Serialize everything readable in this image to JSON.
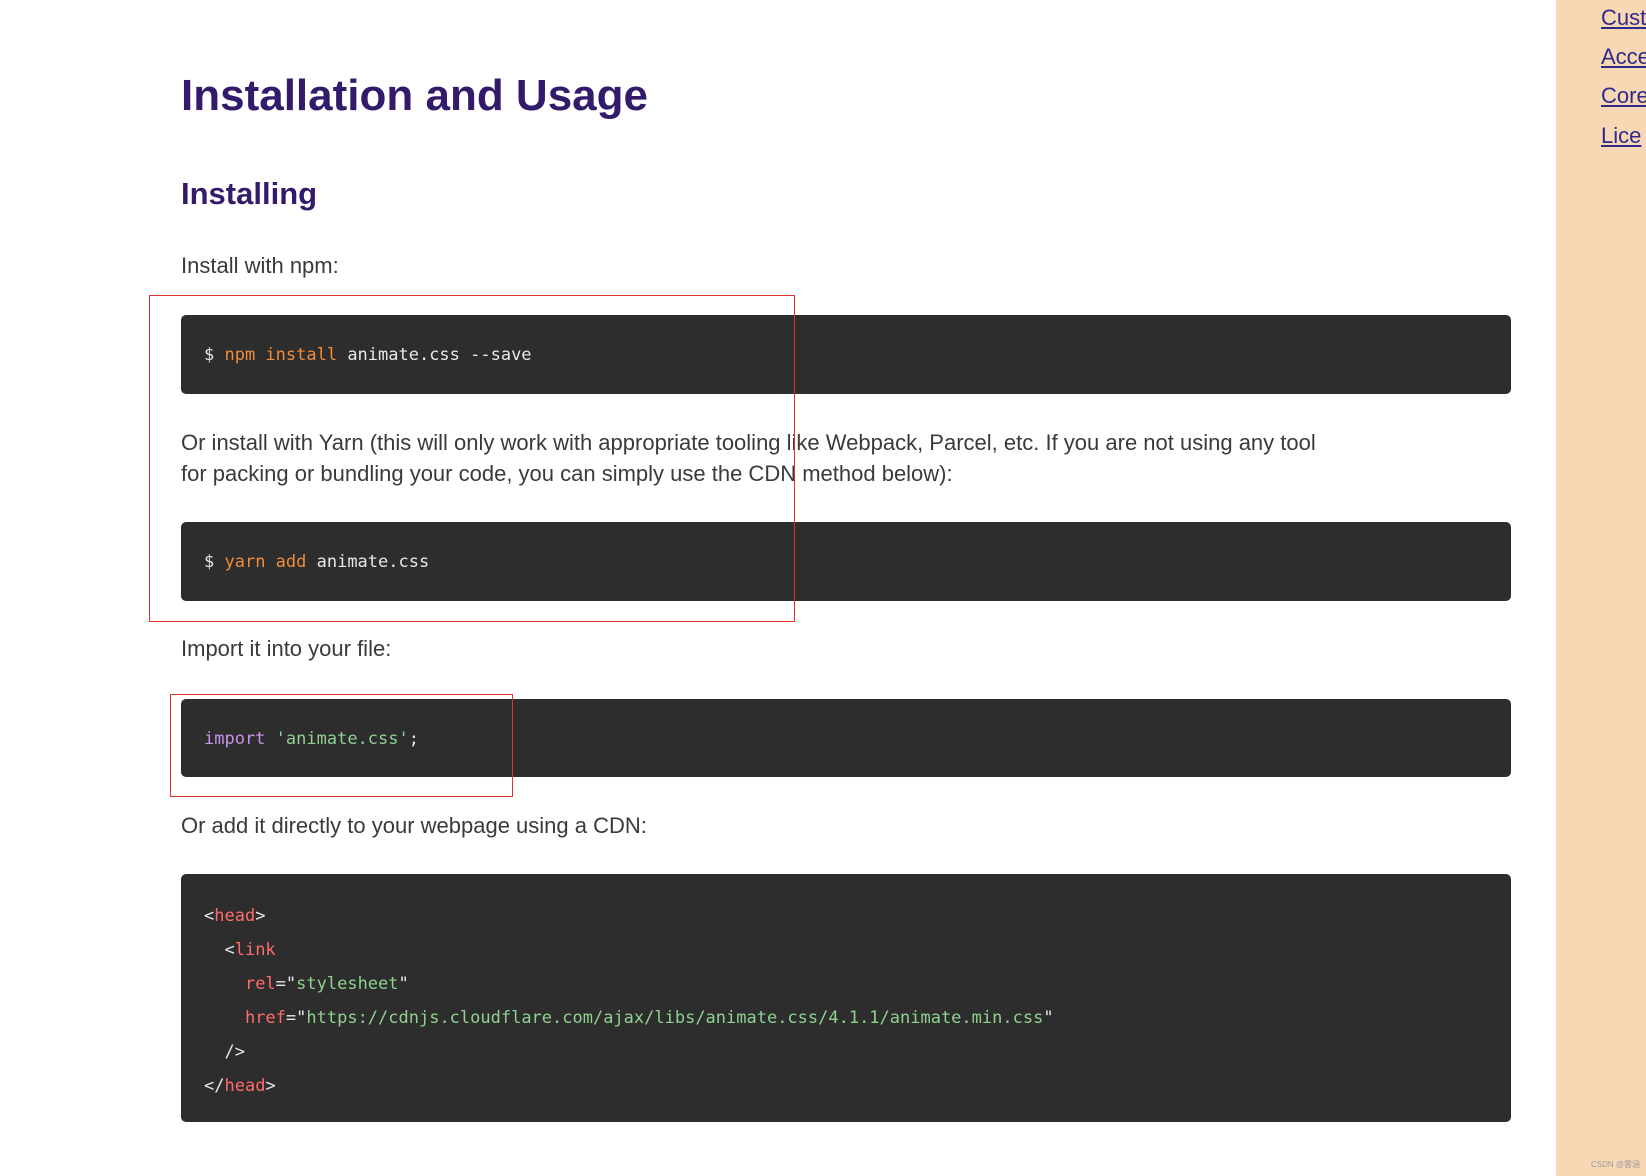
{
  "main": {
    "title": "Installation and Usage",
    "section_installing": "Installing",
    "para_npm": "Install with npm:",
    "code_npm": {
      "prompt": "$ ",
      "cmd": "npm install",
      "args": " animate.css --save"
    },
    "para_yarn_line1": "Or install with Yarn (this will only work with appropriate tooling like Webpack, Parcel, etc. If you are not using any tool",
    "para_yarn_line2": "for packing or bundling your code, you can simply use the CDN method below):",
    "code_yarn": {
      "prompt": "$ ",
      "cmd": "yarn add",
      "args": " animate.css"
    },
    "para_import": "Import it into your file:",
    "code_import": {
      "keyword": "import",
      "space": " ",
      "string": "'animate.css'",
      "end": ";"
    },
    "para_cdn": "Or add it directly to your webpage using a CDN:",
    "code_cdn": {
      "l1_open": "<",
      "l1_tag": "head",
      "l1_close": ">",
      "l2_indent": "  <",
      "l2_tag": "link",
      "l3_indent": "    ",
      "l3_attr": "rel",
      "l3_eq": "=\"",
      "l3_val": "stylesheet",
      "l3_end": "\"",
      "l4_indent": "    ",
      "l4_attr": "href",
      "l4_eq": "=\"",
      "l4_val": "https://cdnjs.cloudflare.com/ajax/libs/animate.css/4.1.1/animate.min.css",
      "l4_end": "\"",
      "l5": "  />",
      "l6_open": "</",
      "l6_tag": "head",
      "l6_close": ">"
    }
  },
  "sidebar": {
    "items": [
      {
        "label": "Cust"
      },
      {
        "label": "Acce"
      },
      {
        "label": "Core"
      },
      {
        "label": "Lice"
      }
    ]
  },
  "watermark": "CSDN @雲涵",
  "colors": {
    "heading": "#331a6b",
    "code_bg": "#2d2d2d",
    "sidebar_bg": "#f8d7b5",
    "annotation": "#e53030"
  }
}
